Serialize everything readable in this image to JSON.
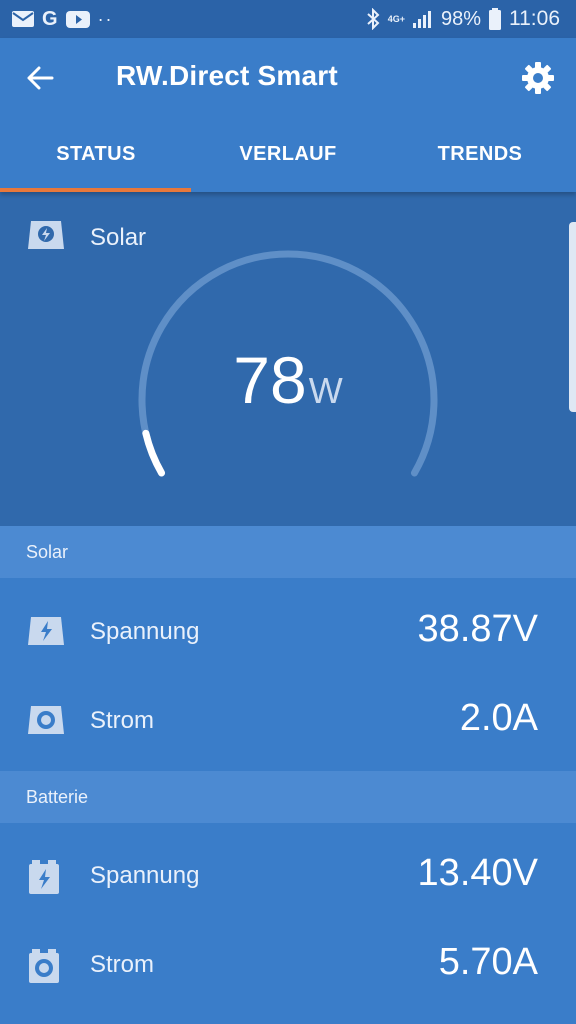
{
  "statusbar": {
    "notif_icons": [
      "mail-icon",
      "google-icon",
      "youtube-icon"
    ],
    "dots": "··",
    "net_label": "4G+",
    "battery_pct": "98%",
    "time": "11:06"
  },
  "appbar": {
    "title": "RW.Direct Smart",
    "back_icon": "arrow-left-icon",
    "settings_icon": "gear-icon"
  },
  "tabs": [
    {
      "label": "STATUS",
      "active": true
    },
    {
      "label": "VERLAUF",
      "active": false
    },
    {
      "label": "TRENDS",
      "active": false
    }
  ],
  "gauge": {
    "label": "Solar",
    "icon": "solar-panel-icon",
    "value": "78",
    "unit": "W",
    "level_fraction": 0.07
  },
  "sections": [
    {
      "title": "Solar",
      "rows": [
        {
          "label": "Spannung",
          "value": "38.87V",
          "icon": "solar-voltage-icon"
        },
        {
          "label": "Strom",
          "value": "2.0A",
          "icon": "solar-current-icon"
        }
      ]
    },
    {
      "title": "Batterie",
      "rows": [
        {
          "label": "Spannung",
          "value": "13.40V",
          "icon": "battery-voltage-icon"
        },
        {
          "label": "Strom",
          "value": "5.70A",
          "icon": "battery-current-icon"
        }
      ]
    }
  ],
  "colors": {
    "primary": "#3a7dc9",
    "statusbar": "#2b63a8",
    "gauge_panel": "#3069ac",
    "section_header": "#4c8ad2",
    "tab_indicator": "#e8783b"
  }
}
